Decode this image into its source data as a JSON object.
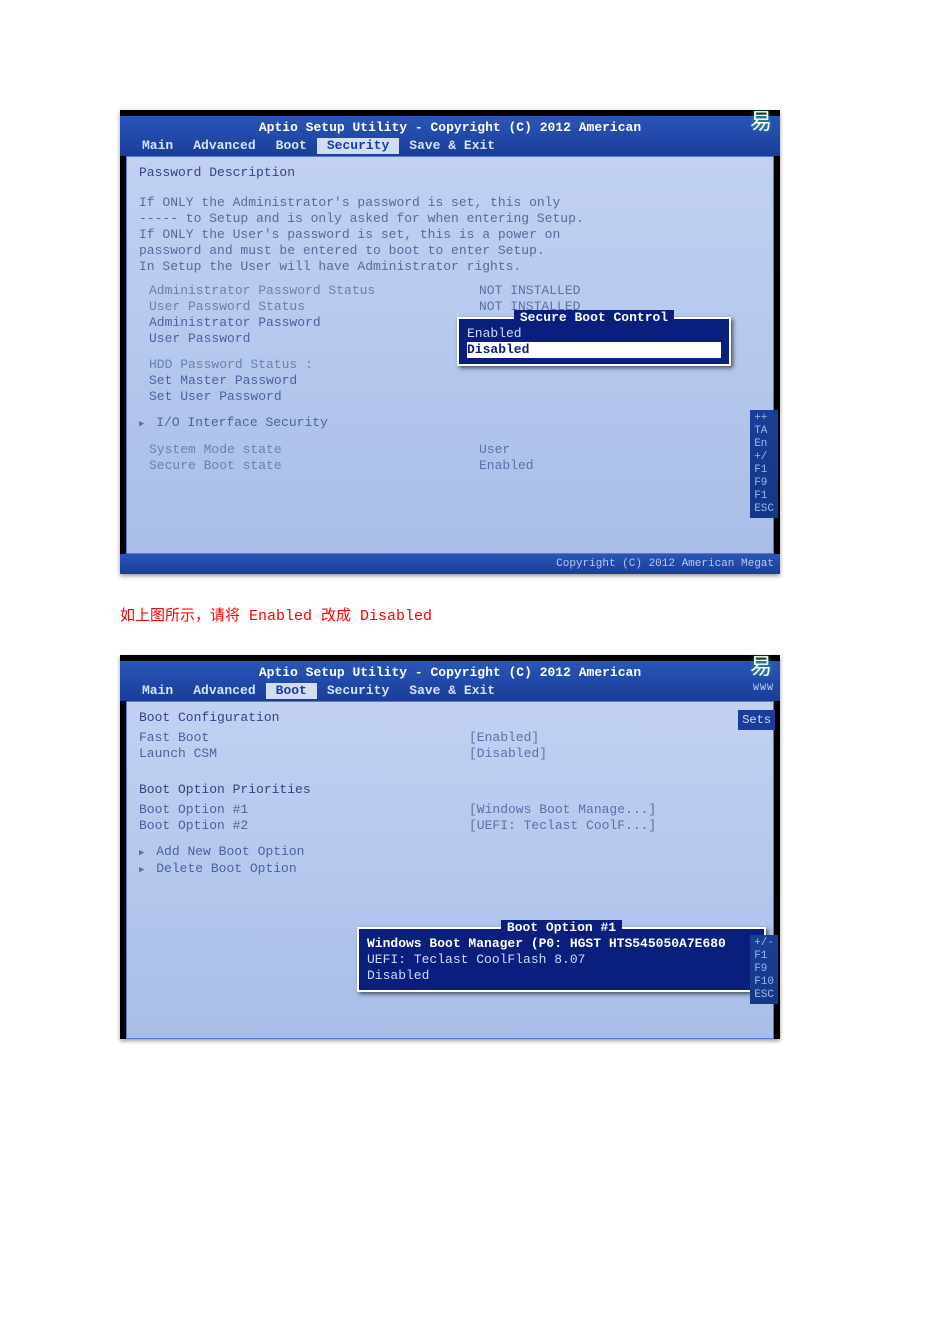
{
  "instruction": "如上图所示，请将 Enabled 改成 Disabled",
  "watermark": "易",
  "shot1": {
    "title": "Aptio Setup Utility - Copyright (C) 2012 American",
    "tabs": [
      "Main",
      "Advanced",
      "Boot",
      "Security",
      "Save & Exit"
    ],
    "active_tab": "Security",
    "heading": "Password Description",
    "desc_lines": [
      "If ONLY the Administrator's password is set, this only",
      "----- to Setup and is only asked for when entering Setup.",
      "If ONLY the User's password is set, this is a power on",
      "password and must be entered to boot to enter Setup.",
      "In Setup the User will have Administrator rights."
    ],
    "items": [
      {
        "k": "Administrator Password Status",
        "v": "NOT INSTALLED"
      },
      {
        "k": "User Password Status",
        "v": "NOT INSTALLED"
      },
      {
        "k": "Administrator Password",
        "v": ""
      },
      {
        "k": "User Password",
        "v": ""
      }
    ],
    "hdd_items": [
      {
        "k": "HDD Password Status  :",
        "v": ""
      },
      {
        "k": "Set Master Password",
        "v": ""
      },
      {
        "k": "Set User Password",
        "v": ""
      }
    ],
    "io_item": "I/O Interface Security",
    "state_items": [
      {
        "k": "System Mode state",
        "v": "User"
      },
      {
        "k": "Secure Boot state",
        "v": "Enabled"
      }
    ],
    "selected_item": {
      "k": "Secure Boot Control",
      "v": "[Disabled]"
    },
    "popup": {
      "title": "Secure Boot Control",
      "opts": [
        "Enabled",
        "Disabled"
      ],
      "highlight": "Disabled"
    },
    "edgehints": [
      "++",
      "TA",
      "En",
      "+/",
      "F1",
      "F9",
      "F1",
      "ESC"
    ],
    "footer": "Copyright (C) 2012 American Megat"
  },
  "shot2": {
    "title": "Aptio Setup Utility - Copyright (C) 2012 American",
    "tabs": [
      "Main",
      "Advanced",
      "Boot",
      "Security",
      "Save & Exit"
    ],
    "active_tab": "Boot",
    "section1": "Boot Configuration",
    "cfg_items": [
      {
        "k": "Fast Boot",
        "v": "[Enabled]"
      },
      {
        "k": "Launch CSM",
        "v": "[Disabled]"
      }
    ],
    "section2": "Boot Option Priorities",
    "prio_items": [
      {
        "k": "Boot Option #1",
        "v": "[Windows Boot Manage...]"
      },
      {
        "k": "Boot Option #2",
        "v": "[UEFI: Teclast CoolF...]"
      }
    ],
    "menu_items": [
      "Add New Boot Option",
      "Delete Boot Option"
    ],
    "popup": {
      "title": "Boot Option #1",
      "opts": [
        "Windows Boot Manager (P0: HGST HTS545050A7E680",
        "UEFI: Teclast CoolFlash 8.07",
        "Disabled"
      ],
      "highlight": "Windows Boot Manager (P0: HGST HTS545050A7E680"
    },
    "sets_label": "Sets",
    "wm2": "WWW",
    "edgehints": [
      "+/-",
      "F1",
      "F9",
      "F10",
      "ESC"
    ]
  }
}
